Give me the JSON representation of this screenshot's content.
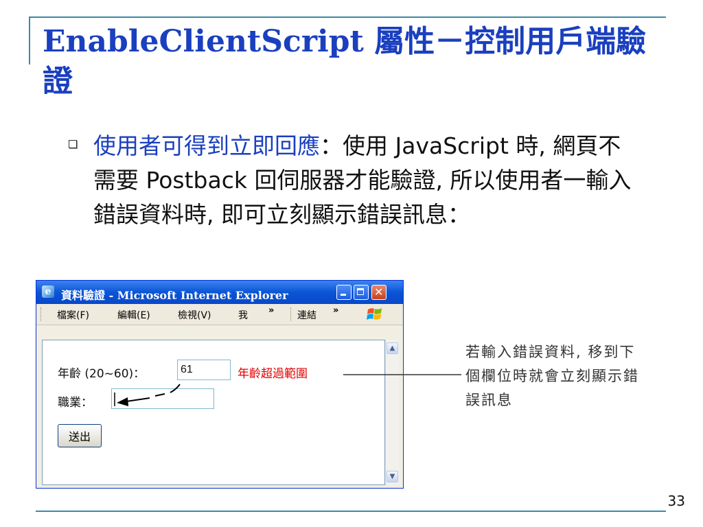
{
  "slide": {
    "title": "EnableClientScript 屬性－控制用戶端驗證",
    "bullet_highlight": "使用者可得到立即回應",
    "bullet_body": "：使用 JavaScript 時, 網頁不需要 Postback 回伺服器才能驗證, 所以使用者一輸入錯誤資料時, 即可立刻顯示錯誤訊息：",
    "page_number": "33"
  },
  "browser": {
    "title": "資料驗證 - Microsoft Internet Explorer",
    "menu": [
      "檔案(F)",
      "編輯(E)",
      "檢視(V)",
      "我"
    ],
    "links_label": "連結",
    "chevron": "»"
  },
  "form": {
    "age_label": "年齡 (20~60)：",
    "age_value": "61",
    "error_text": "年齡超過範圍",
    "job_label": "職業：",
    "submit_label": "送出"
  },
  "callout": {
    "text": "若輸入錯誤資料, 移到下個欄位時就會立刻顯示錯誤訊息"
  }
}
